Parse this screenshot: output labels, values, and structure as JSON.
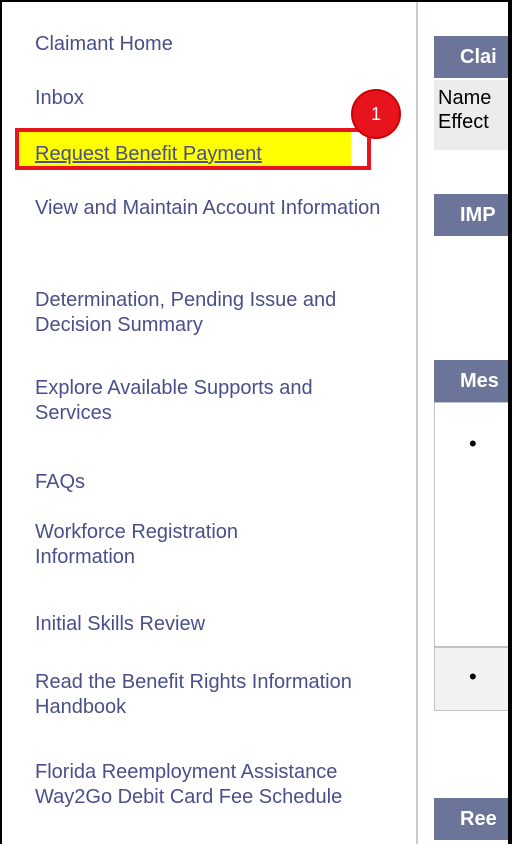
{
  "badge": {
    "number": "1"
  },
  "sidebar": {
    "items": [
      {
        "label": "Claimant Home"
      },
      {
        "label": "Inbox"
      },
      {
        "label": "Request Benefit Payment"
      },
      {
        "label": "View and Maintain Account Information"
      },
      {
        "label": "Determination, Pending Issue and Decision Summary"
      },
      {
        "label": "Explore Available Supports and Services"
      },
      {
        "label": "FAQs"
      },
      {
        "label": "Workforce Registration Information"
      },
      {
        "label": "Initial Skills Review"
      },
      {
        "label": "Read the Benefit Rights Information Handbook"
      },
      {
        "label": "Florida Reemployment Assistance Way2Go Debit Card Fee Schedule"
      }
    ]
  },
  "main": {
    "claim_header": "Clai",
    "name_line": "Name",
    "effective_line": "Effect",
    "imp_header": "IMP",
    "messages_header": "Mes",
    "bullet_1": "•",
    "bullet_2": "•",
    "ree_header": "Ree"
  },
  "colors": {
    "link": "#4a4f8a",
    "highlight": "#ffff00",
    "annotation": "#e8141d",
    "section_header": "#6a7599"
  }
}
